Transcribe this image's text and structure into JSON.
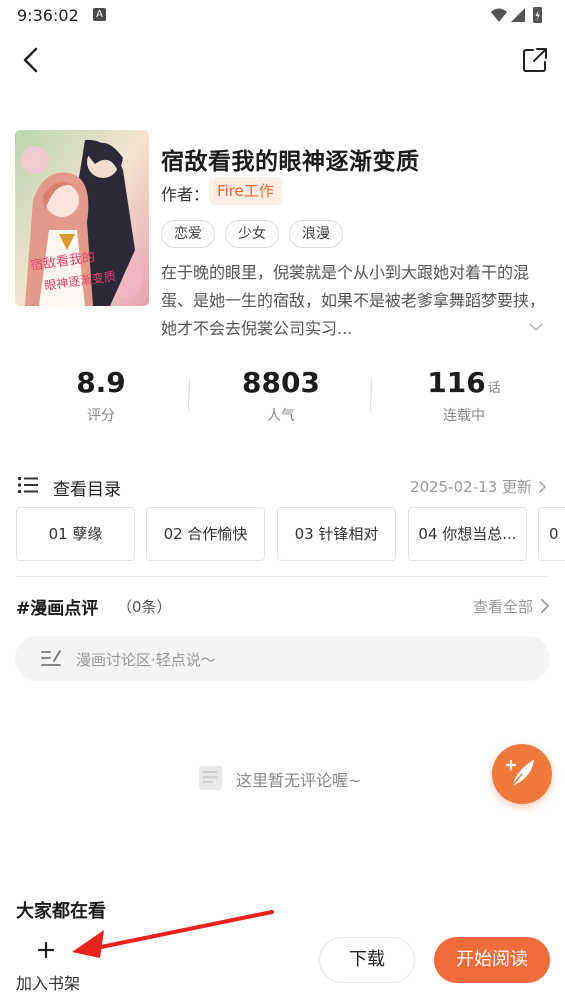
{
  "status_bar": {
    "time": "9:36:02",
    "notification_letter": "A"
  },
  "book": {
    "title": "宿敌看我的眼神逐渐变质",
    "author_label": "作者：",
    "author_name": "Fire工作",
    "tags": [
      "恋爱",
      "少女",
      "浪漫"
    ],
    "description": "在于晚的眼里，倪裳就是个从小到大跟她对着干的混蛋、是她一生的宿敌，如果不是被老爹拿舞蹈梦要挟，她才不会去倪裳公司实习..."
  },
  "stats": {
    "rating": {
      "value": "8.9",
      "label": "评分"
    },
    "popularity": {
      "value": "8803",
      "label": "人气"
    },
    "chapters": {
      "value": "116",
      "unit": "话",
      "label": "连载中"
    }
  },
  "toc": {
    "label": "查看目录",
    "update": "2025-02-13 更新",
    "chapters": [
      "01 孽缘",
      "02 合作愉快",
      "03 针锋相对",
      "04 你想当总...",
      "0"
    ]
  },
  "reviews": {
    "title": "#漫画点评",
    "count": "（0条）",
    "view_all": "查看全部",
    "input_placeholder": "漫画讨论区·轻点说～",
    "empty_text": "这里暂无评论喔~"
  },
  "popular": {
    "title": "大家都在看"
  },
  "bottom_bar": {
    "add_shelf": "加入书架",
    "download": "下载",
    "start_reading": "开始阅读"
  },
  "colors": {
    "accent": "#f26b3a",
    "author_chip_bg": "#fdeee6",
    "annotation_arrow": "#e8231f"
  }
}
